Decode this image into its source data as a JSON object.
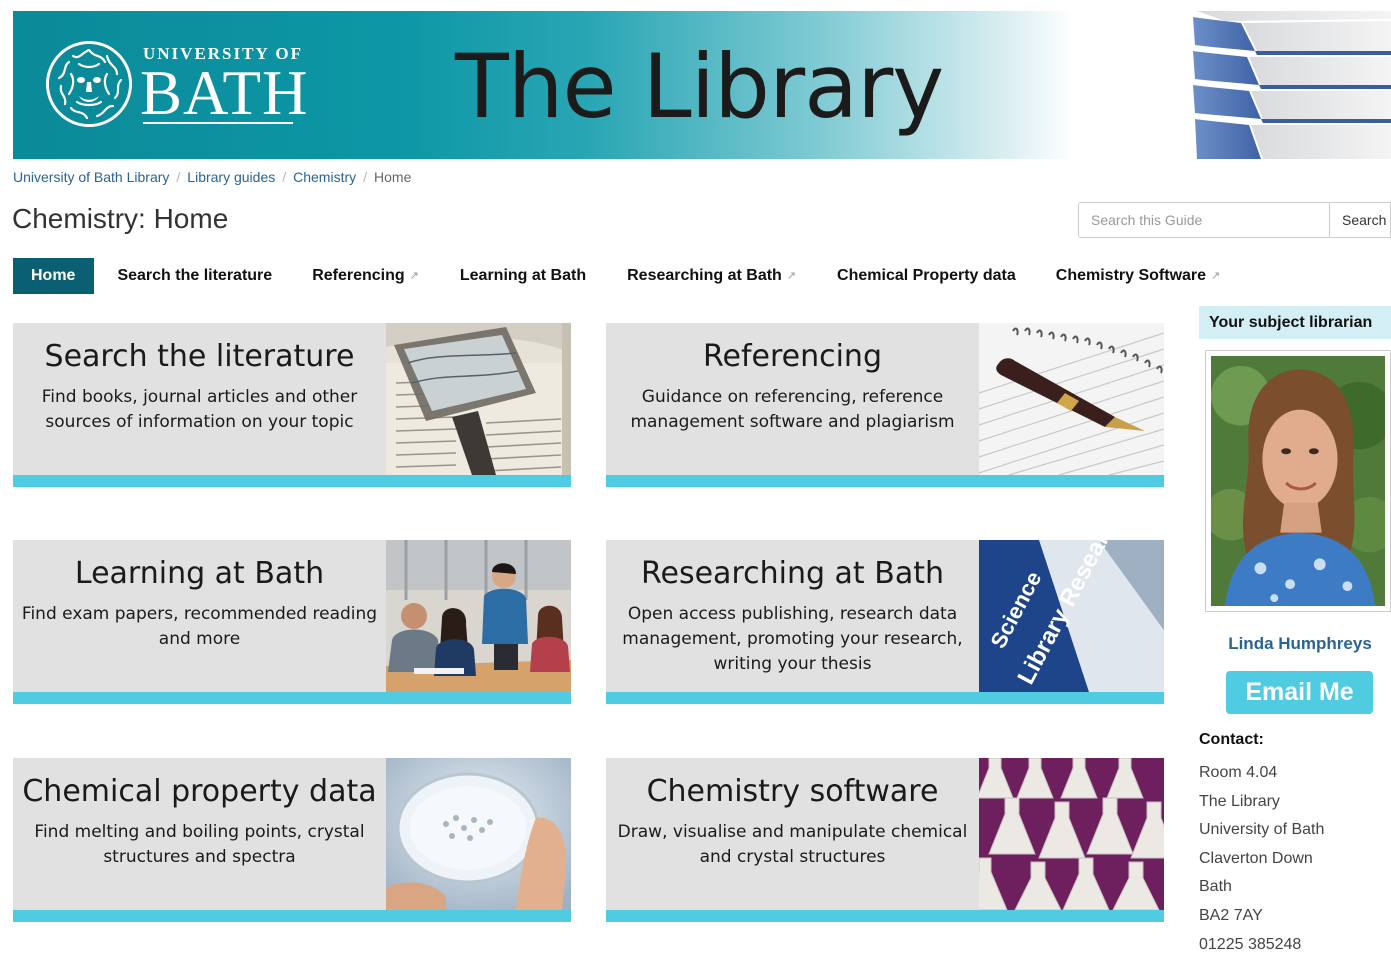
{
  "banner": {
    "university_line1": "UNIVERSITY OF",
    "university_line2": "BATH",
    "title": "The Library"
  },
  "breadcrumb": {
    "items": [
      "University of Bath Library",
      "Library guides",
      "Chemistry"
    ],
    "current": "Home",
    "separator": "/"
  },
  "page_title": "Chemistry: Home",
  "search": {
    "placeholder": "Search this Guide",
    "button": "Search"
  },
  "nav": {
    "tabs": [
      {
        "label": "Home",
        "external": false
      },
      {
        "label": "Search the literature",
        "external": false
      },
      {
        "label": "Referencing",
        "external": true
      },
      {
        "label": "Learning at Bath",
        "external": false
      },
      {
        "label": "Researching at Bath",
        "external": true
      },
      {
        "label": "Chemical Property data",
        "external": false
      },
      {
        "label": "Chemistry Software",
        "external": true
      }
    ],
    "external_icon": "↗"
  },
  "tiles": [
    {
      "title": "Search the literature",
      "line1": "Find books, journal articles and other",
      "line2": "sources of information on your topic",
      "line3": ""
    },
    {
      "title": "Referencing",
      "line1": "Guidance on referencing, reference",
      "line2": "management software and plagiarism",
      "line3": ""
    },
    {
      "title": "Learning at Bath",
      "line1": "Find exam papers, recommended reading",
      "line2": "and more",
      "line3": ""
    },
    {
      "title": "Researching at Bath",
      "line1": "Open access publishing, research data",
      "line2": "management, promoting your research,",
      "line3": "writing your thesis"
    },
    {
      "title": "Chemical property data",
      "line1": "Find melting and boiling points, crystal",
      "line2": "structures and spectra",
      "line3": ""
    },
    {
      "title": "Chemistry software",
      "line1": "Draw, visualise and manipulate chemical",
      "line2": "and crystal structures",
      "line3": ""
    }
  ],
  "tile_image_text": {
    "science": "Science",
    "library_research": "Library Research S"
  },
  "sidebar": {
    "heading": "Your subject librarian",
    "name": "Linda Humphreys",
    "email_button": "Email Me",
    "contact_heading": "Contact:",
    "contact_lines": [
      "Room 4.04",
      "The Library",
      "University of Bath",
      "Claverton Down",
      "Bath",
      "BA2 7AY",
      "01225 385248"
    ]
  },
  "colors": {
    "banner_teal": "#0b8a99",
    "nav_active": "#0b5f73",
    "accent_cyan": "#4fcbe2",
    "link_blue": "#2a6496",
    "tile_grey": "#e1e1e1",
    "sidebar_head_bg": "#d4eef5"
  }
}
